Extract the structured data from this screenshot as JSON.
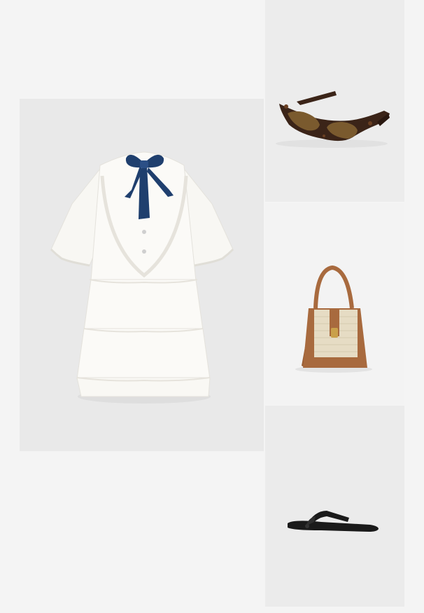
{
  "collage": {
    "items": [
      {
        "id": "dress",
        "icon": "white-ruffled-dress-with-navy-bow"
      },
      {
        "id": "sunglasses",
        "icon": "tortoiseshell-rectangular-sunglasses"
      },
      {
        "id": "bag",
        "icon": "tan-leather-raffia-tote-bag"
      },
      {
        "id": "sandals",
        "icon": "black-thong-sandal"
      }
    ],
    "colors": {
      "page_bg": "#f4f4f4",
      "dress_bg": "#e9e9e9",
      "sunglasses_bg": "#ececec",
      "bag_bg": "#f3f3f3",
      "sandal_bg": "#ebebeb",
      "dress": "#fbfaf7",
      "bow": "#1f3f6e",
      "tortoise": "#3b2418",
      "lens": "#7a5a2e",
      "leather": "#a86a3e",
      "raffia": "#e6dcc4",
      "sandal": "#1a1a1a"
    }
  }
}
